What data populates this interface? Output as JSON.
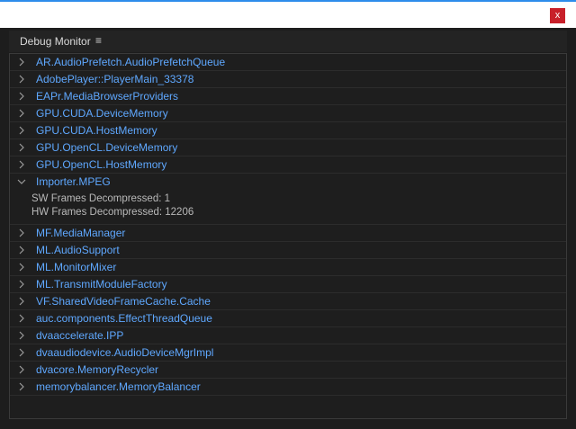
{
  "window": {
    "close_label": "x",
    "accent_color": "#2d8ceb",
    "close_color": "#c8202a"
  },
  "panel": {
    "title": "Debug Monitor",
    "menu_icon": "hamburger-icon"
  },
  "rows": [
    {
      "label": "AR.AudioPrefetch.AudioPrefetchQueue",
      "expanded": false
    },
    {
      "label": "AdobePlayer::PlayerMain_33378",
      "expanded": false
    },
    {
      "label": "EAPr.MediaBrowserProviders",
      "expanded": false
    },
    {
      "label": "GPU.CUDA.DeviceMemory",
      "expanded": false
    },
    {
      "label": "GPU.CUDA.HostMemory",
      "expanded": false
    },
    {
      "label": "GPU.OpenCL.DeviceMemory",
      "expanded": false
    },
    {
      "label": "GPU.OpenCL.HostMemory",
      "expanded": false
    },
    {
      "label": "Importer.MPEG",
      "expanded": true,
      "details": [
        "SW Frames Decompressed: 1",
        "HW Frames Decompressed: 12206"
      ]
    },
    {
      "label": "MF.MediaManager",
      "expanded": false
    },
    {
      "label": "ML.AudioSupport",
      "expanded": false
    },
    {
      "label": "ML.MonitorMixer",
      "expanded": false
    },
    {
      "label": "ML.TransmitModuleFactory",
      "expanded": false
    },
    {
      "label": "VF.SharedVideoFrameCache.Cache",
      "expanded": false
    },
    {
      "label": "auc.components.EffectThreadQueue",
      "expanded": false
    },
    {
      "label": "dvaaccelerate.IPP",
      "expanded": false
    },
    {
      "label": "dvaaudiodevice.AudioDeviceMgrImpl",
      "expanded": false
    },
    {
      "label": "dvacore.MemoryRecycler",
      "expanded": false
    },
    {
      "label": "memorybalancer.MemoryBalancer",
      "expanded": false
    }
  ]
}
